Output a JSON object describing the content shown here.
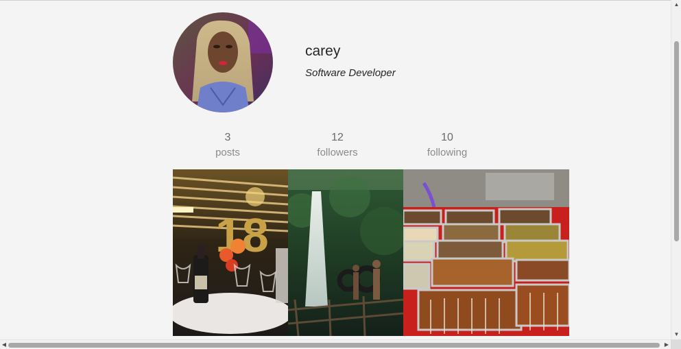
{
  "profile": {
    "username": "carey",
    "bio": "Software Developer",
    "avatar_icon": "profile-photo"
  },
  "stats": [
    {
      "value": "3",
      "label": "posts"
    },
    {
      "value": "12",
      "label": "followers"
    },
    {
      "value": "10",
      "label": "following"
    }
  ],
  "photos": [
    {
      "subject": "birthday-party-balloons-photo"
    },
    {
      "subject": "waterfall-jungle-photo"
    },
    {
      "subject": "street-food-skewers-photo"
    }
  ],
  "colors": {
    "background": "#f4f4f4",
    "text_primary": "#262626",
    "text_muted": "#8a8a8a"
  }
}
